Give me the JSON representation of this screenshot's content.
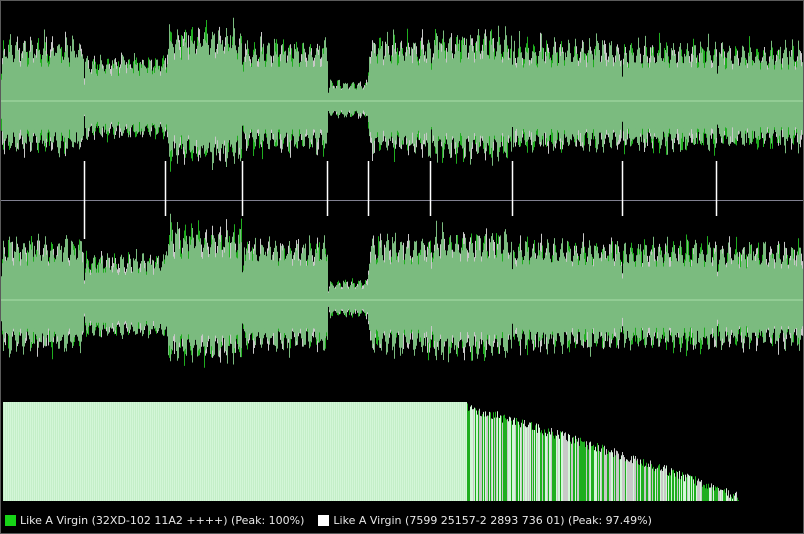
{
  "colors": {
    "background": "#000000",
    "reference_wave": "#1fae1f",
    "compare_wave": "#c8c8c8",
    "overlap_fill": "#7bbb7f",
    "spectrum_fill": "#d4f6d8",
    "centerline": "#a8dca8",
    "channel_divider": "#808090",
    "marker": "#ffffff"
  },
  "legend": [
    {
      "swatch_color": "#17d417",
      "label": "Like A Virgin (32XD-102 11A2 ++++) (Peak: 100%)"
    },
    {
      "swatch_color": "#ffffff",
      "label": "Like A Virgin (7599 25157-2 2893 736 01) (Peak: 97.49%)"
    }
  ],
  "waveform": {
    "channels": 2,
    "segments": [
      {
        "level": 0.82
      },
      {
        "level": 0.6
      },
      {
        "level": 0.98
      },
      {
        "level": 0.8
      },
      {
        "level": 0.26
      },
      {
        "level": 0.85
      },
      {
        "level": 0.92
      },
      {
        "level": 0.8
      },
      {
        "level": 0.78
      },
      {
        "level": 0.75
      },
      {
        "level": 0.8
      }
    ],
    "segment_boundaries": [
      0.103,
      0.205,
      0.3,
      0.407,
      0.457,
      0.535,
      0.637,
      0.774,
      0.892
    ],
    "spectrum_rolloff_start": 0.58,
    "spectrum_end": 0.92
  }
}
